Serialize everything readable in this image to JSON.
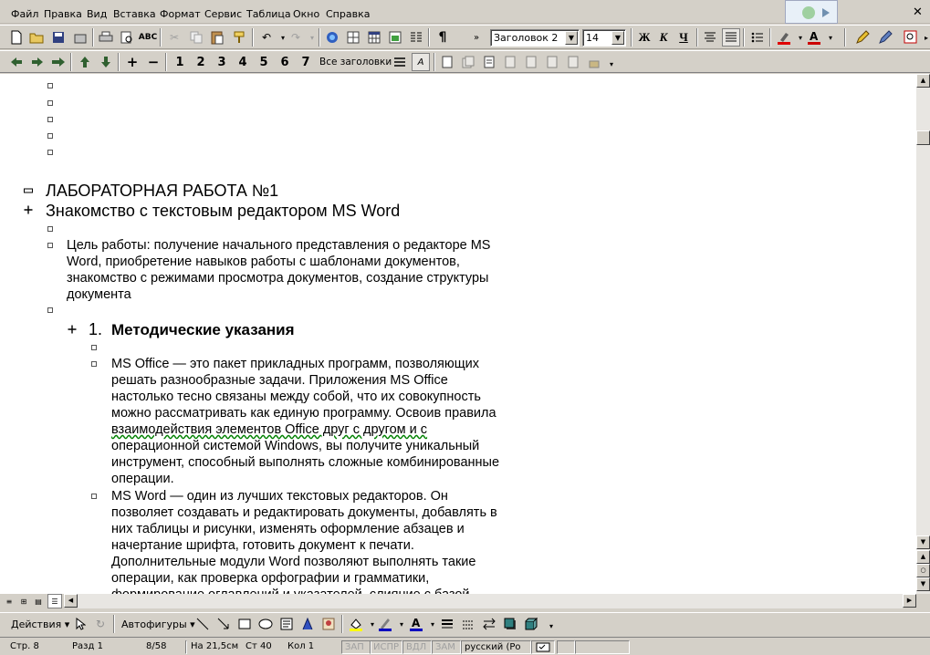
{
  "menu": {
    "items": [
      "Файл",
      "Правка",
      "Вид",
      "Вставка",
      "Формат",
      "Сервис",
      "Таблица",
      "Окно",
      "Справка"
    ],
    "close_glyph": "✕"
  },
  "toolbar": {
    "style_value": "Заголовок 2",
    "size_value": "14",
    "bold_label": "Ж",
    "italic_label": "К",
    "underline_label": "Ч",
    "pilcrow": "¶"
  },
  "outline_toolbar": {
    "levels": [
      "1",
      "2",
      "3",
      "4",
      "5",
      "6",
      "7"
    ],
    "show_all_label": "Все заголовки"
  },
  "document": {
    "heading1": "ЛАБОРАТОРНАЯ РАБОТА №1",
    "heading1b": "Знакомство с текстовым редактором MS Word",
    "goal_text": "Цель работы: получение начального представления о редакторе MS\nWord, приобретение навыков работы  с шаблонами документов,\nзнакомство с режимами просмотра документов, создание структуры\nдокумента",
    "section_num": "1.",
    "section_title": "Методические указания",
    "para1_lines": [
      "MS Office — это пакет прикладных программ, позволяющих",
      "решать разнообразные задачи. Приложения MS Office",
      "настолько тесно связаны между собой, что их совокупность",
      "можно рассматривать как единую программу. Освоив правила",
      "взаимодействия элементов Office друг с другом и с",
      "операционной системой Windows, вы получите уникальный",
      "инструмент, способный выполнять сложные комбинированные",
      "операции."
    ],
    "para2_lines": [
      "MS Word — один из лучших текстовых редакторов. Он",
      "позволяет создавать и редактировать документы, добавлять в",
      "них таблицы и рисунки, изменять оформление абзацев и",
      "начертание шрифта, готовить документ к печати.",
      "Дополнительные модули Word позволяют выполнять такие",
      "операции, как проверка орфографии и грамматики,",
      "формирование оглавлений и указателей, слияние с базой"
    ]
  },
  "drawing": {
    "actions_label": "Действия ▾",
    "autoshapes_label": "Автофигуры ▾"
  },
  "status": {
    "page": "Стр.  8",
    "section": "Разд  1",
    "pages": "8/58",
    "at": "На 21,5см",
    "line": "Ст  40",
    "col": "Кол  1",
    "rec": "ЗАП",
    "trk": "ИСПР",
    "ext": "ВДЛ",
    "ovr": "ЗАМ",
    "lang": "русский (Ро"
  },
  "colors": {
    "chrome": "#d4d0c8",
    "highlight_red": "#e00000",
    "font_color": "#cc0000"
  }
}
